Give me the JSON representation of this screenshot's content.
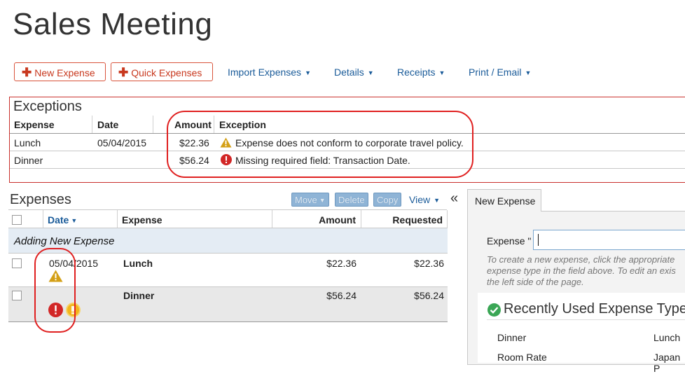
{
  "page": {
    "title": "Sales Meeting"
  },
  "toolbar": {
    "new_expense": "New Expense",
    "quick_expenses": "Quick Expenses",
    "import_expenses": "Import Expenses",
    "details": "Details",
    "receipts": "Receipts",
    "print_email": "Print / Email",
    "caret": "▼"
  },
  "exceptions": {
    "title": "Exceptions",
    "columns": [
      "Expense",
      "Date",
      "Amount",
      "Exception"
    ],
    "rows": [
      {
        "expense": "Lunch",
        "date": "05/04/2015",
        "amount": "$22.36",
        "exception": "Expense does not conform to corporate travel policy.",
        "icon": "warning-icon"
      },
      {
        "expense": "Dinner",
        "date": "",
        "amount": "$56.24",
        "exception": "Missing required field: Transaction Date.",
        "icon": "error-icon"
      }
    ]
  },
  "expenses": {
    "title": "Expenses",
    "actions": {
      "move": "Move",
      "delete": "Delete",
      "copy": "Copy",
      "view": "View",
      "collapse": "«"
    },
    "columns": {
      "date": "Date",
      "expense": "Expense",
      "amount": "Amount",
      "requested": "Requested"
    },
    "group_label": "Adding New Expense",
    "rows": [
      {
        "date": "05/04/2015",
        "expense": "Lunch",
        "amount": "$22.36",
        "requested": "$22.36",
        "icons": [
          "warning-icon"
        ]
      },
      {
        "date": "",
        "expense": "Dinner",
        "amount": "$56.24",
        "requested": "$56.24",
        "icons": [
          "error-icon",
          "alert-icon"
        ]
      }
    ]
  },
  "new_expense_panel": {
    "tab": "New Expense",
    "field_label": "Expense \"",
    "hint": "To create a new expense, click the appropriate expense type in the field above. To edit an exis the left side of the page.",
    "hint_lines": [
      "To create a new expense, click the appropriate",
      "expense type in the field above. To edit an exis",
      "the left side of the page."
    ],
    "recent_title": "Recently Used Expense Types",
    "recent_items": [
      "Dinner",
      "Lunch",
      "Room Rate",
      "Japan P"
    ]
  },
  "colors": {
    "accent_red": "#c8381e",
    "link_blue": "#1a5b99",
    "warning": "#d4a017",
    "error": "#d22727",
    "success": "#3aa655"
  }
}
